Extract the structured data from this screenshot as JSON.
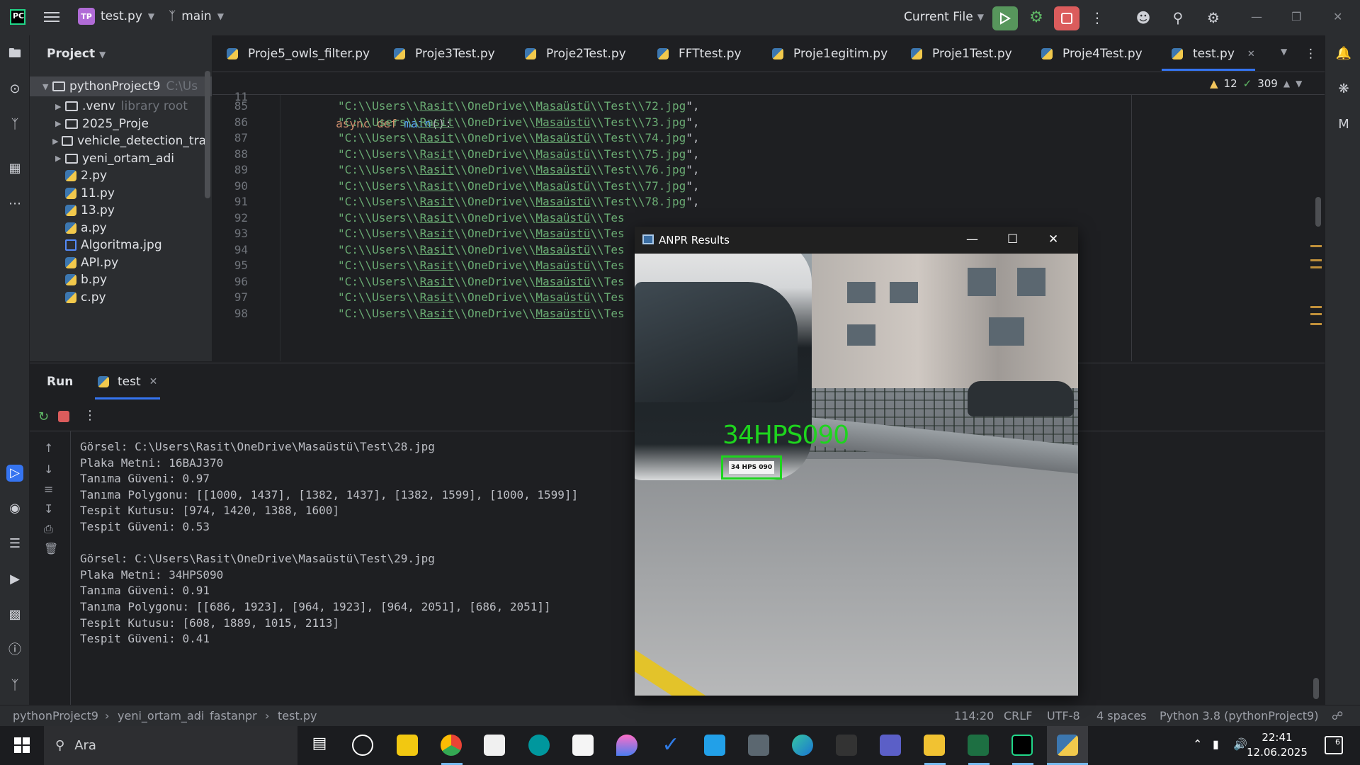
{
  "titlebar": {
    "project_badge": "TP",
    "project_name": "test.py",
    "branch": "main",
    "run_config": "Current File"
  },
  "project_panel": {
    "header": "Project",
    "root": {
      "name": "pythonProject9",
      "path": "C:\\Us"
    },
    "items": [
      {
        "name": ".venv",
        "note": "library root",
        "kind": "folder"
      },
      {
        "name": "2025_Proje",
        "note": "",
        "kind": "folder"
      },
      {
        "name": "vehicle_detection_tra",
        "note": "",
        "kind": "folder"
      },
      {
        "name": "yeni_ortam_adi",
        "note": "",
        "kind": "folder"
      },
      {
        "name": "2.py",
        "note": "",
        "kind": "py"
      },
      {
        "name": "11.py",
        "note": "",
        "kind": "py"
      },
      {
        "name": "13.py",
        "note": "",
        "kind": "py"
      },
      {
        "name": "a.py",
        "note": "",
        "kind": "py"
      },
      {
        "name": "Algoritma.jpg",
        "note": "",
        "kind": "img"
      },
      {
        "name": "API.py",
        "note": "",
        "kind": "py"
      },
      {
        "name": "b.py",
        "note": "",
        "kind": "py"
      },
      {
        "name": "c.py",
        "note": "",
        "kind": "py"
      }
    ]
  },
  "tabs": [
    "Proje5_owls_filter.py",
    "Proje3Test.py",
    "Proje2Test.py",
    "FFTtest.py",
    "Proje1egitim.py",
    "Proje1Test.py",
    "Proje4Test.py",
    "test.py"
  ],
  "editor": {
    "sticky": {
      "line": "11",
      "kw": "async def ",
      "fn": "main",
      "rest": "():"
    },
    "inspections": {
      "warnings": "12",
      "ok": "309"
    },
    "lines": [
      {
        "n": "85",
        "file": "72.jpg"
      },
      {
        "n": "86",
        "file": "73.jpg"
      },
      {
        "n": "87",
        "file": "74.jpg"
      },
      {
        "n": "88",
        "file": "75.jpg"
      },
      {
        "n": "89",
        "file": "76.jpg"
      },
      {
        "n": "90",
        "file": "77.jpg"
      },
      {
        "n": "91",
        "file": "78.jpg"
      },
      {
        "n": "92",
        "file": ""
      },
      {
        "n": "93",
        "file": ""
      },
      {
        "n": "94",
        "file": ""
      },
      {
        "n": "95",
        "file": ""
      },
      {
        "n": "96",
        "file": ""
      },
      {
        "n": "97",
        "file": ""
      },
      {
        "n": "98",
        "file": ""
      }
    ],
    "path_prefix": "\"C:\\\\Users\\\\",
    "user": "Rasit",
    "mid": "\\\\OneDrive\\\\",
    "folder": "Masaüstü",
    "tail": "\\\\Test\\\\",
    "tail_truncated": "\\\\Tes"
  },
  "run": {
    "title": "Run",
    "tab": "test",
    "output": [
      "Görsel: C:\\Users\\Rasit\\OneDrive\\Masaüstü\\Test\\28.jpg",
      "Plaka Metni: 16BAJ370",
      "Tanıma Güveni: 0.97",
      "Tanıma Polygonu: [[1000, 1437], [1382, 1437], [1382, 1599], [1000, 1599]]",
      "Tespit Kutusu: [974, 1420, 1388, 1600]",
      "Tespit Güveni: 0.53",
      "",
      "Görsel: C:\\Users\\Rasit\\OneDrive\\Masaüstü\\Test\\29.jpg",
      "Plaka Metni: 34HPS090",
      "Tanıma Güveni: 0.91",
      "Tanıma Polygonu: [[686, 1923], [964, 1923], [964, 2051], [686, 2051]]",
      "Tespit Kutusu: [608, 1889, 1015, 2113]",
      "Tespit Güveni: 0.41"
    ]
  },
  "anpr_window": {
    "title": "ANPR Results",
    "plate_overlay": "34HPS090",
    "plate_on_image": "34 HPS 090"
  },
  "statusbar": {
    "crumbs": [
      "pythonProject9",
      "yeni_ortam_adi",
      "fastanpr",
      "test.py"
    ],
    "position": "114:20",
    "line_sep": "CRLF",
    "encoding": "UTF-8",
    "indent": "4 spaces",
    "interpreter": "Python 3.8 (pythonProject9)"
  },
  "taskbar": {
    "search_placeholder": "Ara",
    "time": "22:41",
    "date": "12.06.2025",
    "notif_count": "6"
  }
}
